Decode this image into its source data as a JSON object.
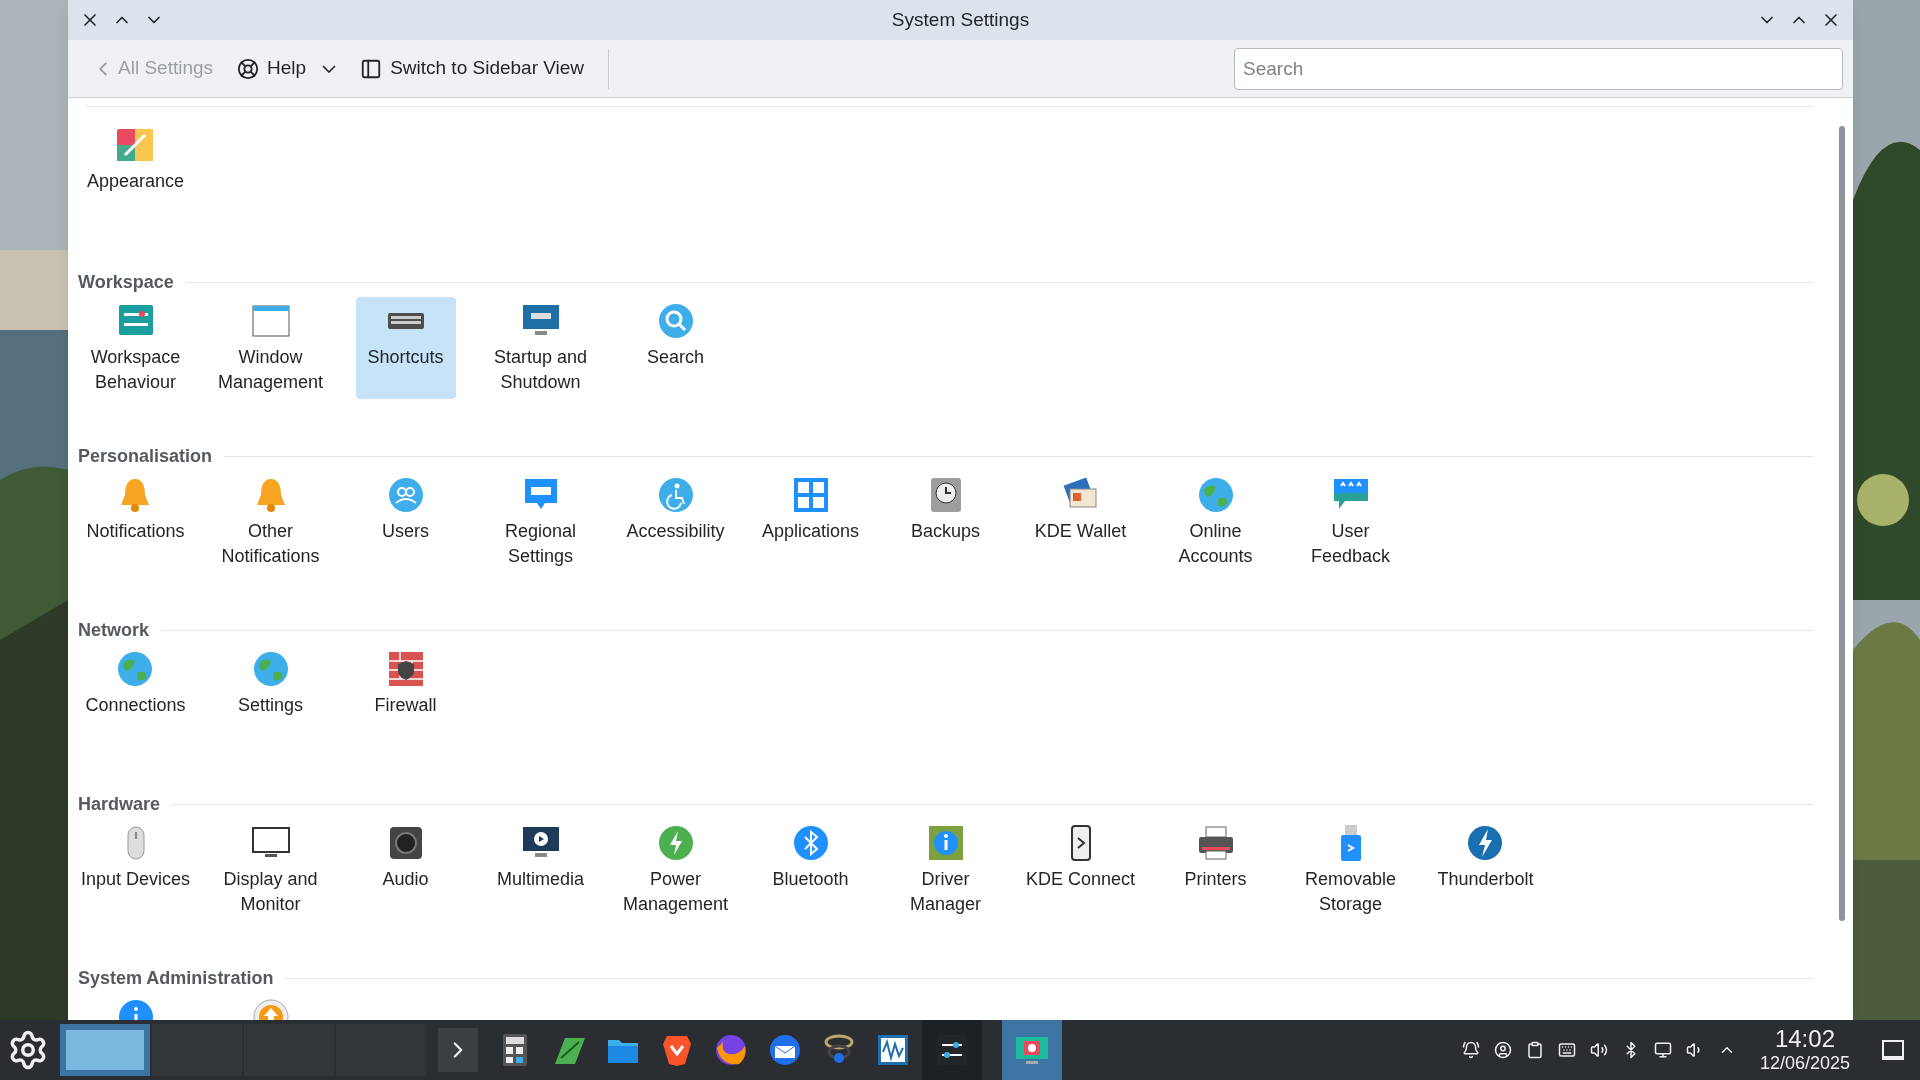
{
  "window": {
    "title": "System Settings"
  },
  "toolbar": {
    "back": {
      "label": "All Settings",
      "disabled": true
    },
    "help": {
      "label": "Help"
    },
    "switch": {
      "label": "Switch to Sidebar View"
    },
    "search": {
      "placeholder": "Search"
    }
  },
  "sections": [
    {
      "items": [
        {
          "label": "Appearance",
          "selected": false
        }
      ]
    },
    {
      "title": "Workspace",
      "items": [
        {
          "label": "Workspace Behaviour",
          "selected": false
        },
        {
          "label": "Window Management",
          "selected": false
        },
        {
          "label": "Shortcuts",
          "selected": true
        },
        {
          "label": "Startup and Shutdown",
          "selected": false
        },
        {
          "label": "Search",
          "selected": false
        }
      ]
    },
    {
      "title": "Personalisation",
      "items": [
        {
          "label": "Notifications",
          "selected": false
        },
        {
          "label": "Other Notifications",
          "selected": false
        },
        {
          "label": "Users",
          "selected": false
        },
        {
          "label": "Regional Settings",
          "selected": false
        },
        {
          "label": "Accessibility",
          "selected": false
        },
        {
          "label": "Applications",
          "selected": false
        },
        {
          "label": "Backups",
          "selected": false
        },
        {
          "label": "KDE Wallet",
          "selected": false
        },
        {
          "label": "Online Accounts",
          "selected": false
        },
        {
          "label": "User Feedback",
          "selected": false
        }
      ]
    },
    {
      "title": "Network",
      "items": [
        {
          "label": "Connections",
          "selected": false
        },
        {
          "label": "Settings",
          "selected": false
        },
        {
          "label": "Firewall",
          "selected": false
        }
      ]
    },
    {
      "title": "Hardware",
      "items": [
        {
          "label": "Input Devices",
          "selected": false
        },
        {
          "label": "Display and Monitor",
          "selected": false
        },
        {
          "label": "Audio",
          "selected": false
        },
        {
          "label": "Multimedia",
          "selected": false
        },
        {
          "label": "Power Management",
          "selected": false
        },
        {
          "label": "Bluetooth",
          "selected": false
        },
        {
          "label": "Driver Manager",
          "selected": false
        },
        {
          "label": "KDE Connect",
          "selected": false
        },
        {
          "label": "Printers",
          "selected": false
        },
        {
          "label": "Removable Storage",
          "selected": false
        },
        {
          "label": "Thunderbolt",
          "selected": false
        }
      ]
    },
    {
      "title": "System Administration",
      "items": [
        {
          "selected": false
        },
        {
          "selected": false
        }
      ]
    }
  ],
  "taskbar": {
    "desktops": [
      {
        "selected": true
      },
      {
        "selected": false
      },
      {
        "selected": false
      },
      {
        "selected": false
      }
    ],
    "apps": [
      {
        "open": false,
        "selected": false
      },
      {
        "open": false,
        "selected": false
      },
      {
        "open": false,
        "selected": false
      },
      {
        "open": false,
        "selected": false
      },
      {
        "open": false,
        "selected": false
      },
      {
        "open": false,
        "selected": false
      },
      {
        "open": false,
        "selected": false
      },
      {
        "open": false,
        "selected": false
      },
      {
        "open": true,
        "selected": false
      },
      {
        "open": true,
        "selected": true
      }
    ],
    "clock": {
      "time": "14:02",
      "date": "12/06/2025"
    }
  }
}
